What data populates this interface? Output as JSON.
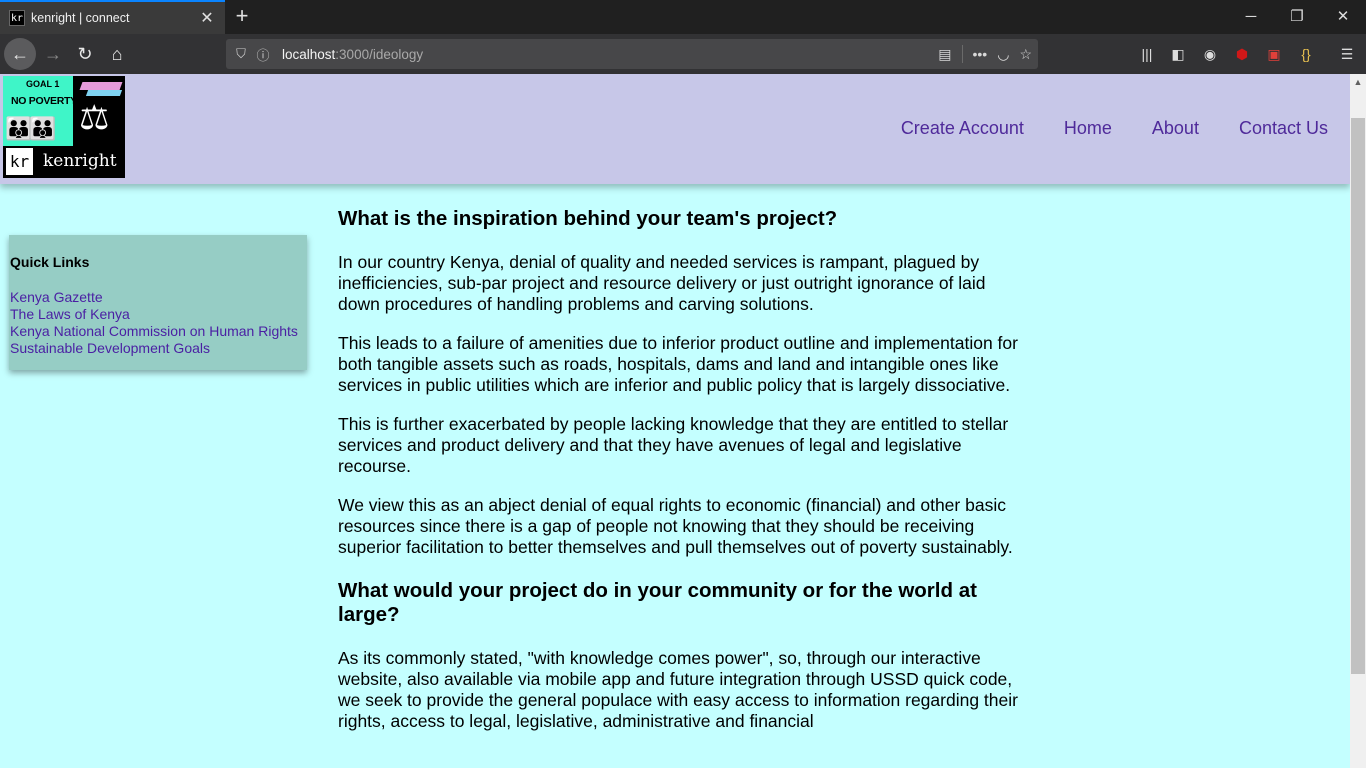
{
  "browser": {
    "tab_title": "kenright | connect",
    "favicon_text": "kr",
    "url_host": "localhost",
    "url_rest": ":3000/ideology"
  },
  "site": {
    "logo": {
      "goal": "GOAL 1",
      "caption": "NO POVERTY",
      "kr": "kr",
      "name": "kenright"
    },
    "nav": [
      "Create Account",
      "Home",
      "About",
      "Contact Us"
    ]
  },
  "quick_links": {
    "title": "Quick Links",
    "links": [
      "Kenya Gazette",
      "The Laws of Kenya",
      "Kenya National Commission on Human Rights",
      "Sustainable Development Goals"
    ]
  },
  "article": {
    "heading1": "What is the inspiration behind your team's project?",
    "p1": "In our country Kenya, denial of quality and needed services is rampant, plagued by inefficiencies, sub-par project and resource delivery or just outright ignorance of laid down procedures of handling problems and carving solutions.",
    "p2": "This leads to a failure of amenities due to inferior product outline and implementation for both tangible assets such as roads, hospitals, dams and land and intangible ones like services in public utilities which are inferior and public policy that is largely dissociative.",
    "p3": "This is further exacerbated by people lacking knowledge that they are entitled to stellar services and product delivery and that they have avenues of legal and legislative recourse.",
    "p4": "We view this as an abject denial of equal rights to economic (financial) and other basic resources since there is a gap of people not knowing that they should be receiving superior facilitation to better themselves and pull themselves out of poverty sustainably.",
    "heading2": "What would your project do in your community or for the world at large?",
    "p5": "As its commonly stated, \"with knowledge comes power\", so, through our interactive website, also available via mobile app and future integration through USSD quick code, we seek to provide the general populace with easy access to information regarding their rights, access to legal, legislative, administrative and financial"
  }
}
